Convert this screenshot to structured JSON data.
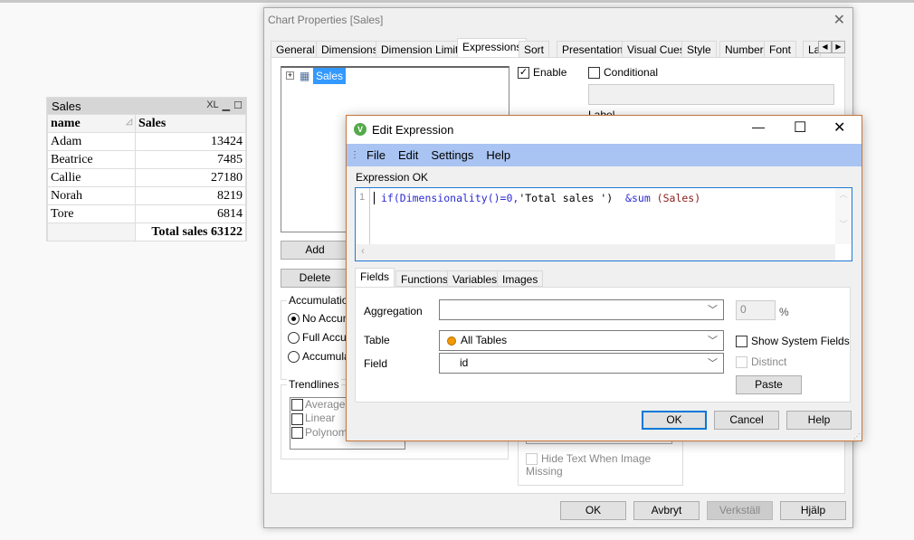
{
  "sales_table": {
    "title": "Sales",
    "icons": [
      "xl-icon",
      "minimize-icon",
      "maximize-icon"
    ],
    "xl_label": "XL",
    "columns": [
      "name",
      "Sales"
    ],
    "rows": [
      {
        "name": "Adam",
        "sales": "13424"
      },
      {
        "name": "Beatrice",
        "sales": "7485"
      },
      {
        "name": "Callie",
        "sales": "27180"
      },
      {
        "name": "Norah",
        "sales": "8219"
      },
      {
        "name": "Tore",
        "sales": "6814"
      }
    ],
    "total": "Total sales 63122"
  },
  "chart_properties": {
    "title": "Chart Properties [Sales]",
    "tabs": [
      "General",
      "Dimensions",
      "Dimension Limits",
      "Expressions",
      "Sort",
      "Presentation",
      "Visual Cues",
      "Style",
      "Number",
      "Font",
      "La"
    ],
    "active_tab": "Expressions",
    "tree_item": "Sales",
    "enable_label": "Enable",
    "enable_checked": true,
    "conditional_label": "Conditional",
    "conditional_checked": false,
    "label_label": "Label",
    "add_label": "Add",
    "delete_label": "Delete",
    "accumulation": {
      "label": "Accumulation",
      "options": [
        "No Accum",
        "Full Accum",
        "Accumulat"
      ],
      "selected": 0
    },
    "trendlines": {
      "label": "Trendlines",
      "options": [
        "Average",
        "Linear",
        "Polynomia"
      ]
    },
    "hide_text_label": "Hide Text When Image Missing",
    "buttons": {
      "ok": "OK",
      "cancel": "Avbryt",
      "apply": "Verkställ",
      "help": "Hjälp"
    }
  },
  "edit_expression": {
    "title": "Edit Expression",
    "menu": [
      "File",
      "Edit",
      "Settings",
      "Help"
    ],
    "status": "Expression OK",
    "line_number": "1",
    "code": {
      "p1": "if(Dimensionality()=0,",
      "p2": "'Total sales '",
      "p3": ")  ",
      "p4": "&sum ",
      "p5": "(Sales)"
    },
    "tabs": [
      "Fields",
      "Functions",
      "Variables",
      "Images"
    ],
    "active_tab": "Fields",
    "aggregation_label": "Aggregation",
    "aggregation_value": "",
    "percent_value": "0",
    "percent_sign": "%",
    "table_label": "Table",
    "table_value": "All Tables",
    "field_label": "Field",
    "field_value": "id",
    "show_system_fields_label": "Show System Fields",
    "distinct_label": "Distinct",
    "paste_label": "Paste",
    "buttons": {
      "ok": "OK",
      "cancel": "Cancel",
      "help": "Help"
    },
    "colors": {
      "accent_border": "#c8763a",
      "menubar": "#a9c4f2",
      "keyword": "#2b2bd6",
      "string": "#000000",
      "field": "#8b1a1a"
    }
  }
}
